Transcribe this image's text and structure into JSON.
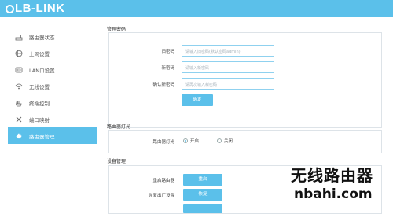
{
  "brand": {
    "logo_text": "LB-LINK"
  },
  "sidebar": {
    "items": [
      {
        "label": "路由器状态",
        "icon": "router-status-icon",
        "active": false
      },
      {
        "label": "上网设置",
        "icon": "globe-icon",
        "active": false
      },
      {
        "label": "LAN口设置",
        "icon": "lan-port-icon",
        "active": false
      },
      {
        "label": "无线设置",
        "icon": "wifi-icon",
        "active": false
      },
      {
        "label": "终端控制",
        "icon": "hand-control-icon",
        "active": false
      },
      {
        "label": "端口映射",
        "icon": "tools-icon",
        "active": false
      },
      {
        "label": "路由器管理",
        "icon": "gear-icon",
        "active": true
      }
    ]
  },
  "password_section": {
    "title": "管理密码",
    "old_label": "旧密码",
    "old_placeholder": "请输入旧密码(默认密码admin)",
    "new_label": "新密码",
    "new_placeholder": "请输入新密码",
    "confirm_label": "确认新密码",
    "confirm_placeholder": "请再次输入新密码",
    "submit_label": "确定"
  },
  "led_section": {
    "title": "路由器灯光",
    "label": "路由器灯光",
    "on_label": "开启",
    "off_label": "关闭",
    "selected": "on"
  },
  "device_section": {
    "title": "设备管理",
    "reboot_label": "重启路由器",
    "reboot_button": "重启",
    "reset_label": "恢复出厂设置",
    "reset_button": "恢复"
  },
  "watermark": {
    "title": "无线路由器",
    "url": "nbahi.com"
  },
  "colors": {
    "accent": "#5bc0ea",
    "border": "#dde3e8",
    "input_border": "#8fd1ef"
  }
}
